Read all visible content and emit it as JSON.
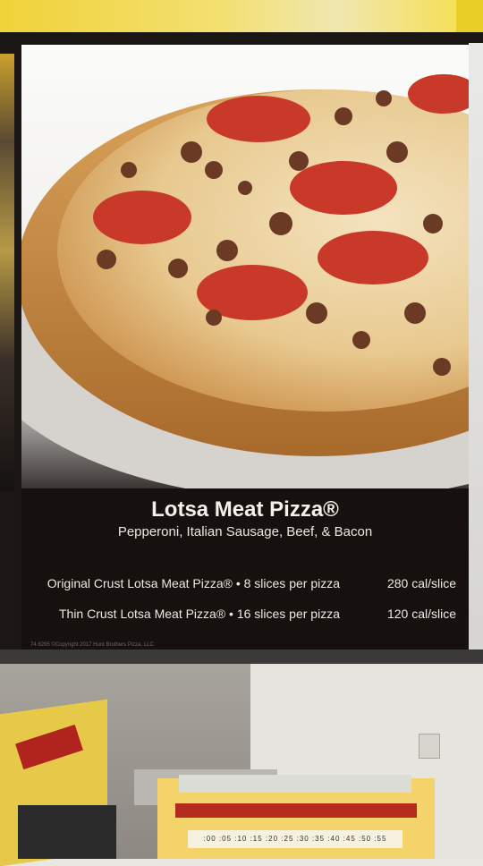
{
  "menu_board": {
    "title": "Lotsa Meat Pizza®",
    "description": "Pepperoni, Italian Sausage, Beef, & Bacon",
    "options": [
      {
        "name": "Original Crust Lotsa Meat Pizza® • 8 slices per pizza",
        "calories": "280 cal/slice"
      },
      {
        "name": "Thin Crust Lotsa Meat Pizza® • 16 slices per pizza",
        "calories": "120 cal/slice"
      }
    ],
    "copyright": "74 8295 ©Copyright 2017 Hunt Brothers Pizza, LLC"
  },
  "pizza_box": {
    "scale": ":00 :05 :10 :15 :20 :25 :30 :35 :40 :45 :50 :55"
  },
  "colors": {
    "board_background": "#16110f",
    "sign_text": "#f4f1ec",
    "box_yellow": "#f3d36a",
    "box_red": "#b52a1f"
  }
}
